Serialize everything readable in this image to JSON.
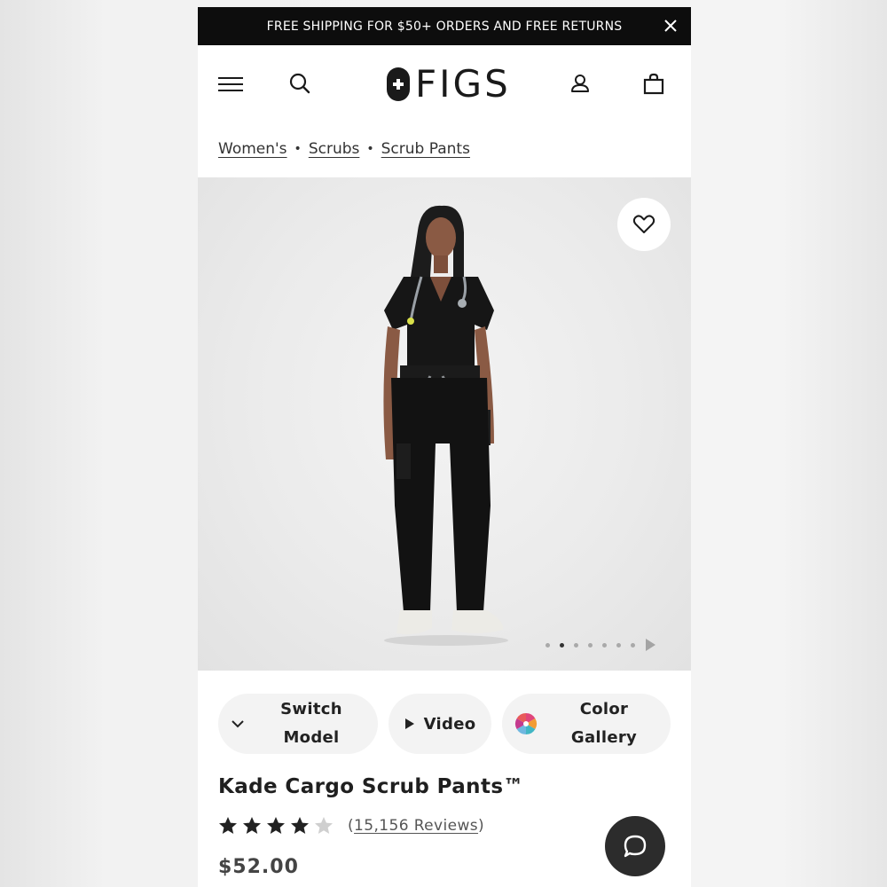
{
  "promo": {
    "text": "FREE SHIPPING FOR $50+ ORDERS AND FREE RETURNS"
  },
  "header": {
    "brand": "FIGS"
  },
  "breadcrumb": [
    {
      "label": "Women's"
    },
    {
      "label": "Scrubs"
    },
    {
      "label": "Scrub Pants"
    }
  ],
  "gallery": {
    "total_images": 7,
    "active_index": 1
  },
  "actions": {
    "switch_model_line1": "Switch",
    "switch_model_line2": "Model",
    "video": "Video",
    "color_gallery_line1": "Color",
    "color_gallery_line2": "Gallery"
  },
  "product": {
    "title": "Kade Cargo Scrub Pants™",
    "rating": 4.6,
    "rating_max": 5,
    "reviews_open": "(",
    "reviews_link": "15,156 Reviews",
    "reviews_close": ")",
    "price": "$52.00"
  },
  "colors": {
    "promo_bg": "#0d0d0d",
    "text": "#1f1f1f",
    "pill_bg": "#f3f3f3",
    "chat_bg": "#2c2c2c"
  },
  "icons": [
    "close-icon",
    "menu-icon",
    "search-icon",
    "account-icon",
    "bag-icon",
    "heart-icon",
    "chevron-down-icon",
    "play-icon",
    "color-wheel-icon",
    "star-icon",
    "chat-icon",
    "next-arrow-icon"
  ]
}
